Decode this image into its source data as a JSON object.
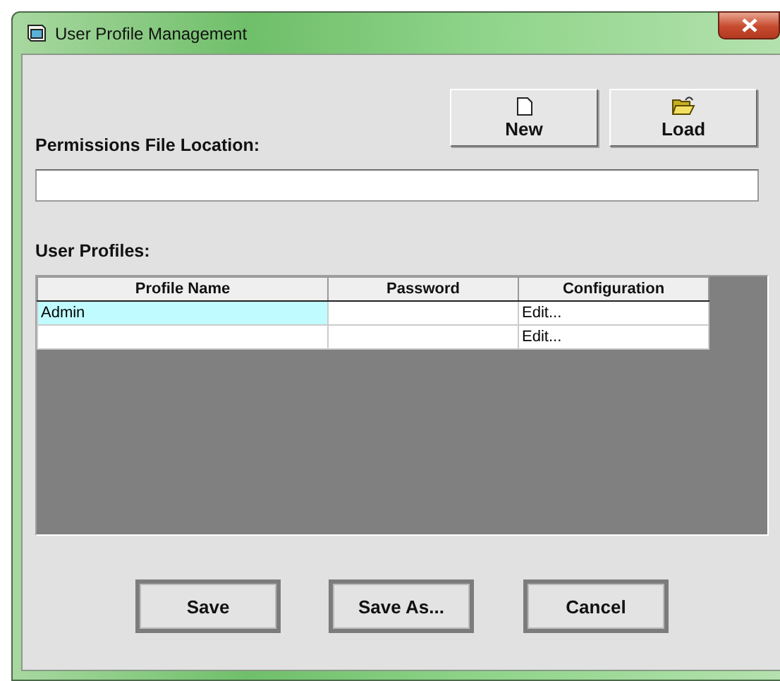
{
  "window": {
    "title": "User Profile Management"
  },
  "toolbar": [
    {
      "kind": "new",
      "label": "New"
    },
    {
      "kind": "load",
      "label": "Load"
    }
  ],
  "permissions_file": {
    "label": "Permissions File Location:"
  },
  "profiles": {
    "label": "User Profiles:",
    "columns": [
      "Profile Name",
      "Password",
      "Configuration"
    ],
    "rows": [
      {
        "profile_name": "Admin",
        "configuration": "Edit...",
        "selected": true
      },
      {
        "configuration": "Edit...",
        "selected": false
      }
    ]
  },
  "buttons": [
    "Save",
    "Save As...",
    "Cancel"
  ]
}
